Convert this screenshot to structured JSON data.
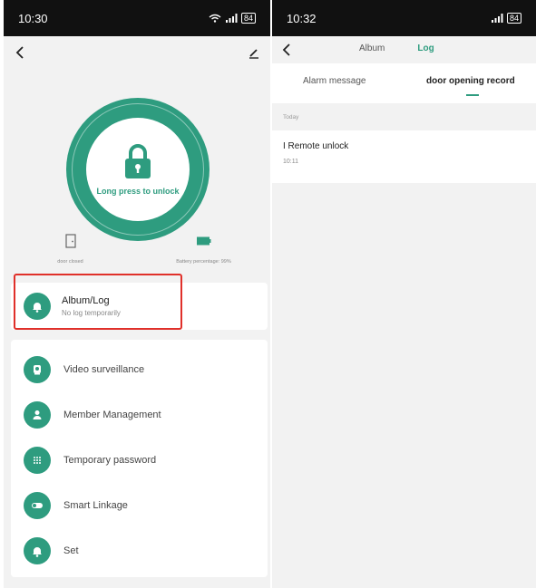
{
  "left": {
    "status_time": "10:30",
    "battery": "84",
    "lock_button_label": "Long press to unlock",
    "door_status": "door closed",
    "battery_status": "Battery percentage: 99%",
    "album": {
      "title": "Album/Log",
      "subtitle": "No log temporarily"
    },
    "menu": [
      {
        "label": "Video surveillance",
        "icon": "camera-icon"
      },
      {
        "label": "Member Management",
        "icon": "person-icon"
      },
      {
        "label": "Temporary password",
        "icon": "keypad-icon"
      },
      {
        "label": "Smart Linkage",
        "icon": "toggle-icon"
      },
      {
        "label": "Set",
        "icon": "bell-icon"
      }
    ]
  },
  "right": {
    "status_time": "10:32",
    "battery": "84",
    "tabs": [
      {
        "label": "Album",
        "active": false
      },
      {
        "label": "Log",
        "active": true
      }
    ],
    "subtabs": [
      {
        "label": "Alarm message",
        "active": false
      },
      {
        "label": "door opening record",
        "active": true
      }
    ],
    "section_label": "Today",
    "records": [
      {
        "title": "I Remote unlock",
        "time": "10:11"
      }
    ]
  },
  "colors": {
    "accent": "#2e9c7f",
    "highlight": "#e0302a"
  }
}
